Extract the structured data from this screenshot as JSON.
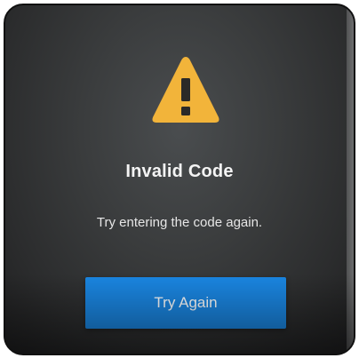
{
  "dialog": {
    "icon": "warning-triangle-icon",
    "title": "Invalid Code",
    "message": "Try entering the code again.",
    "button_label": "Try Again"
  },
  "colors": {
    "icon_yellow": "#f2b43a",
    "button_blue": "#1a86e2",
    "background": "#3a3c3d",
    "text": "#f4f4f4"
  }
}
